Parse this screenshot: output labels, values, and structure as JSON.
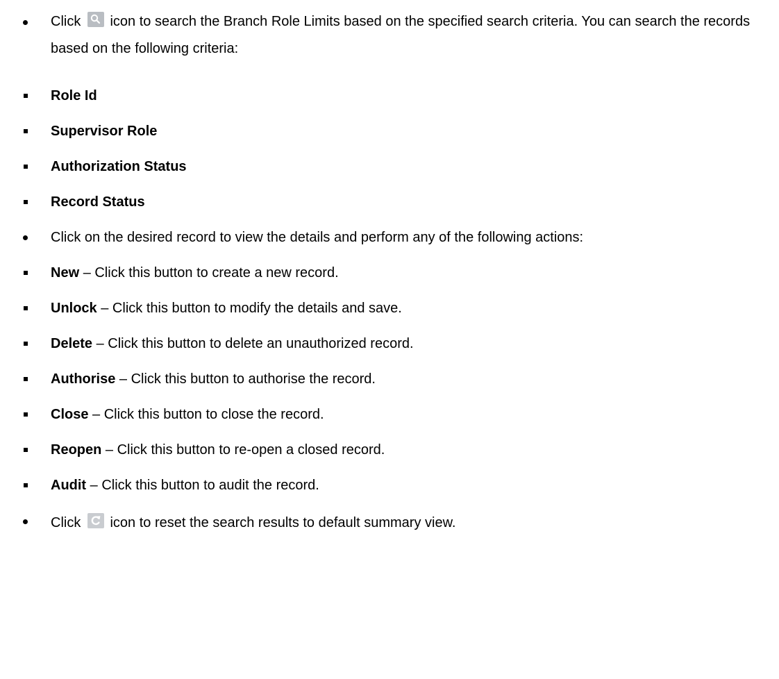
{
  "search_item": {
    "prefix": "Click",
    "icon": "search-icon",
    "text": "icon to search the Branch Role Limits based on the specified search criteria. You can search the records based on the following criteria:"
  },
  "criteria": [
    "Role Id",
    "Supervisor Role",
    "Authorization Status",
    "Record Status"
  ],
  "actions_intro": "Click on the desired record to view the details and perform any of the following actions:",
  "actions": [
    {
      "label": "New",
      "description": "– Click this button to create a new record."
    },
    {
      "label": "Unlock",
      "description": "– Click this button to modify the details and save."
    },
    {
      "label": "Delete",
      "description": "– Click this button to delete an unauthorized record."
    },
    {
      "label": "Authorise",
      "description": "– Click this button to authorise the record."
    },
    {
      "label": "Close",
      "description": "– Click this button to close the record."
    },
    {
      "label": "Reopen",
      "description": "– Click this button to re-open a closed record."
    },
    {
      "label": "Audit",
      "description": "– Click this button to audit the record."
    }
  ],
  "reset_item": {
    "prefix": "Click",
    "icon": "reset-icon",
    "text": "icon to reset the search results to default summary view."
  }
}
